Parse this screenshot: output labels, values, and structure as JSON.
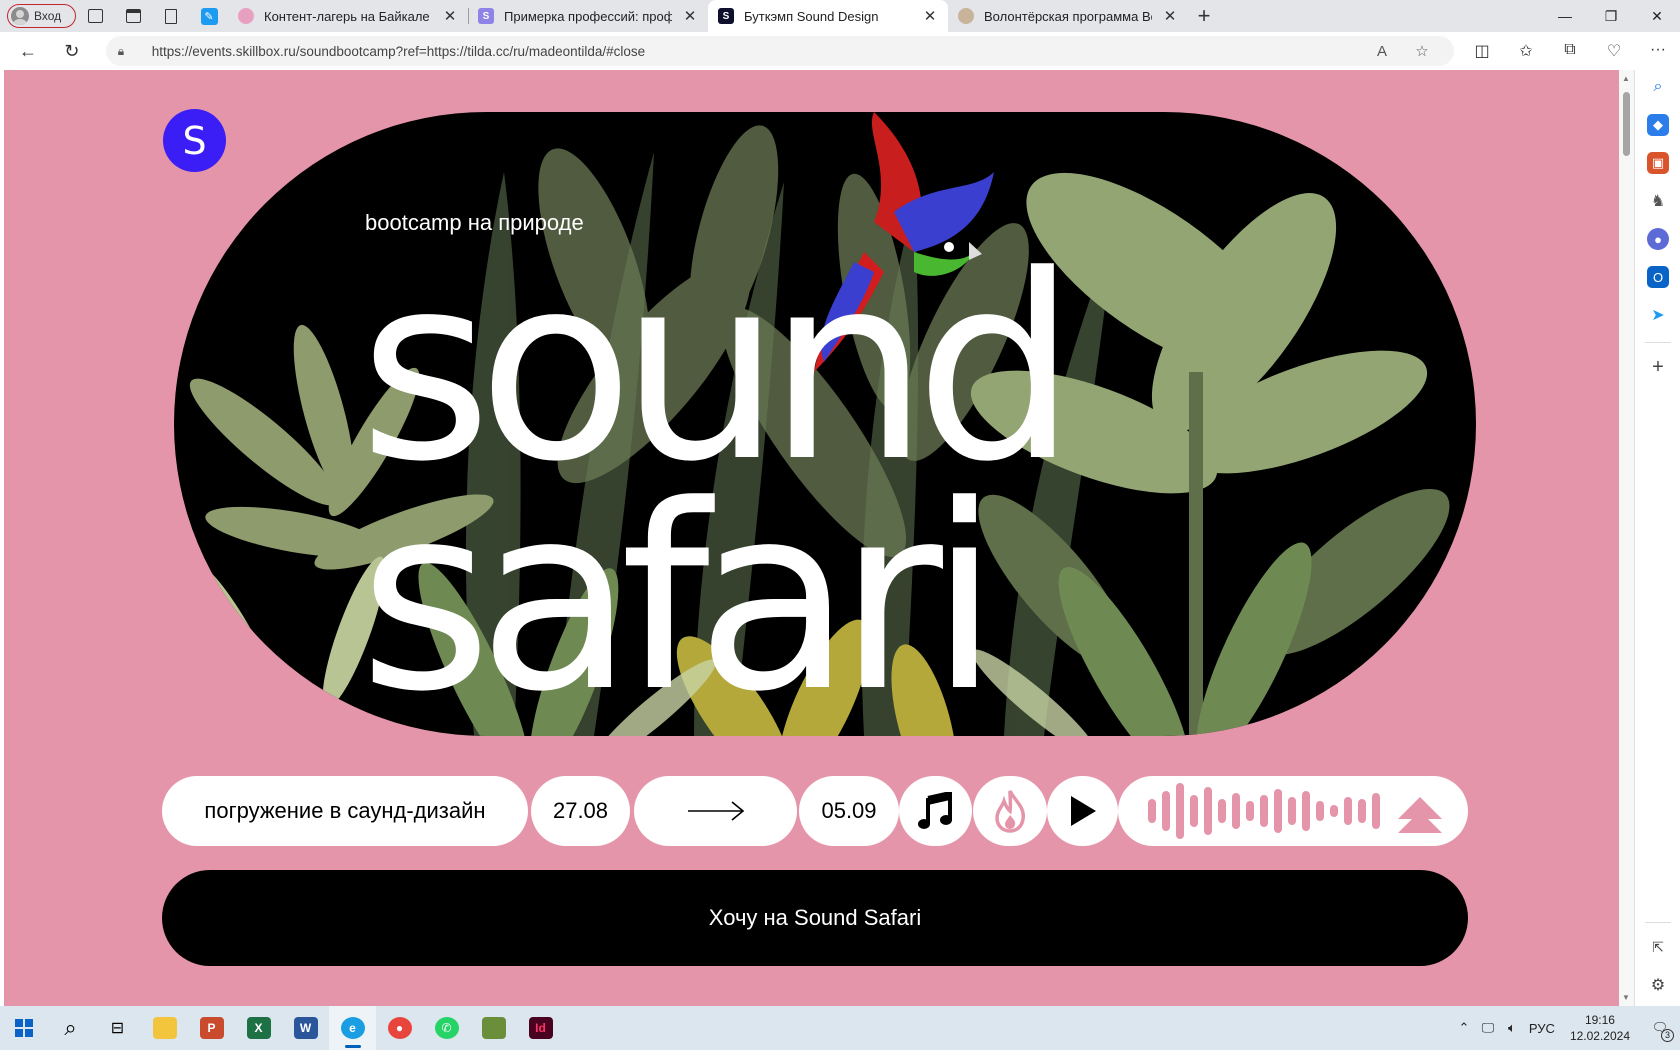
{
  "browser": {
    "profile_label": "Вход",
    "tabs": [
      {
        "title": "Контент-лагерь на Байкале",
        "favicon_color": "#e8a0c0",
        "active": false
      },
      {
        "title": "Примерка профессий: профори",
        "favicon_color": "#8f83e8",
        "favicon_letter": "S",
        "active": false
      },
      {
        "title": "Буткэмп Sound Design",
        "favicon_color": "#0f0f2e",
        "favicon_letter": "S",
        "active": true
      },
      {
        "title": "Волонтёрская программа Всем",
        "favicon_color": "#c7b49a",
        "active": false
      }
    ],
    "url": "https://events.skillbox.ru/soundbootcamp?ref=https://tilda.cc/ru/madeontilda/#close"
  },
  "page": {
    "logo_letter": "S",
    "subtitle": "bootcamp на природе",
    "title_line1": "sound",
    "title_line2": "safari",
    "pills": {
      "topic": "погружение в саунд-дизайн",
      "date_start": "27.08",
      "date_end": "05.09"
    },
    "cta_label": "Хочу на Sound Safari",
    "colors": {
      "page_bg": "#e595aa",
      "logo_bg": "#3b1df5",
      "accent_pink": "#e595aa"
    }
  },
  "taskbar": {
    "language": "РУС",
    "time": "19:16",
    "date": "12.02.2024",
    "notification_count": "3"
  }
}
